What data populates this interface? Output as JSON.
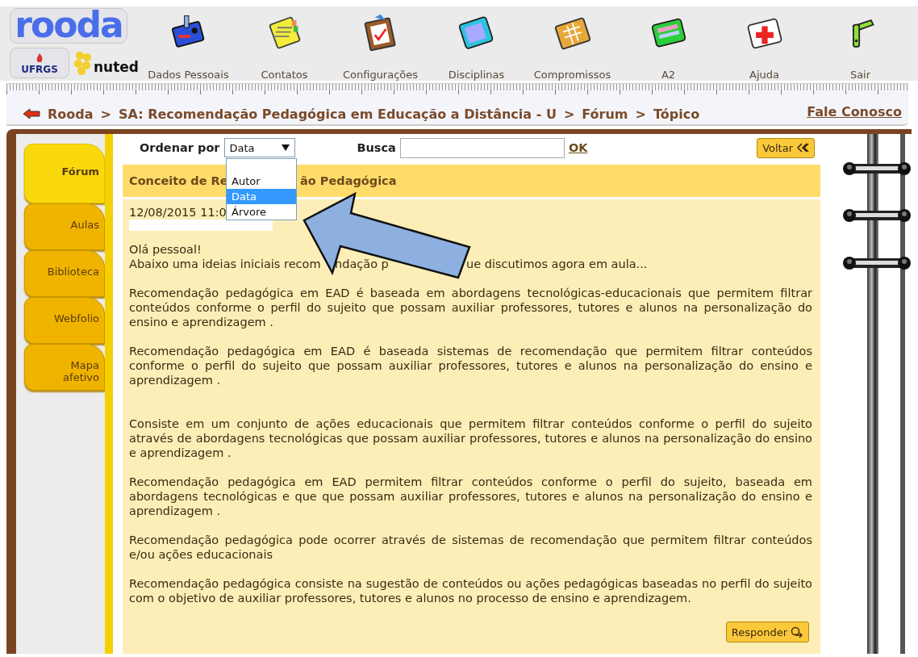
{
  "logos": {
    "rooda": "rooda",
    "ufrgs": "UFRGS",
    "nuted": "nuted"
  },
  "nav": [
    {
      "label": "Dados Pessoais"
    },
    {
      "label": "Contatos"
    },
    {
      "label": "Configurações"
    },
    {
      "label": "Disciplinas"
    },
    {
      "label": "Compromissos"
    },
    {
      "label": "A2"
    },
    {
      "label": "Ajuda"
    },
    {
      "label": "Sair"
    }
  ],
  "breadcrumb": {
    "items": [
      "Rooda",
      "SA: Recomendação Pedagógica em Educação a Distância - U",
      "Fórum",
      "Tópico"
    ],
    "separator": ">",
    "contact_link": "Fale Conosco"
  },
  "side_tabs": [
    {
      "label": "Fórum",
      "selected": true
    },
    {
      "label": "Aulas",
      "selected": false
    },
    {
      "label": "Biblioteca",
      "selected": false
    },
    {
      "label": "Webfolio",
      "selected": false
    },
    {
      "label": "Mapa afetivo",
      "selected": false
    }
  ],
  "toolbar": {
    "sort_label": "Ordenar por",
    "sort_value": "Data",
    "sort_options": [
      {
        "label": "Autor",
        "selected": false
      },
      {
        "label": "Data",
        "selected": true
      },
      {
        "label": "Árvore",
        "selected": false
      }
    ],
    "search_label": "Busca",
    "search_button": "OK",
    "back_button": "Voltar"
  },
  "post": {
    "title_parts": [
      "Conceito de Re",
      "ão Pedagógica"
    ],
    "date": "12/08/2015 11:0",
    "greeting": "Olá pessoal!",
    "intro_parts": [
      "Abaixo uma ideias iniciais recom",
      "ndação p",
      "ue discutimos agora em aula..."
    ],
    "paragraphs": [
      "Recomendação pedagógica em EAD é baseada em abordagens tecnológicas-educacionais que permitem filtrar conteúdos conforme o perfil do sujeito que possam auxiliar professores, tutores e alunos na personalização do ensino e aprendizagem .",
      "Recomendação pedagógica em EAD é baseada sistemas de recomendação que permitem filtrar conteúdos conforme o perfil do sujeito que possam auxiliar professores, tutores e alunos na personalização do ensino e aprendizagem .",
      "Consiste em um conjunto de ações educacionais que permitem filtrar conteúdos conforme o perfil do sujeito através de abordagens tecnológicas que possam auxiliar professores, tutores e alunos na personalização do ensino e aprendizagem .",
      "Recomendação pedagógica em EAD permitem filtrar conteúdos conforme o perfil do sujeito, baseada em abordagens tecnológicas e que que possam auxiliar professores, tutores e alunos na personalização do ensino e aprendizagem .",
      "Recomendação pedagógica pode ocorrer através de sistemas de recomendação que permitem filtrar conteúdos e/ou ações educacionais",
      "Recomendação pedagógica consiste na sugestão de conteúdos ou ações pedagógicas baseadas no perfil do sujeito com o objetivo de auxiliar professores, tutores e alunos no processo de ensino e aprendizagem."
    ],
    "reply_button": "Responder"
  }
}
